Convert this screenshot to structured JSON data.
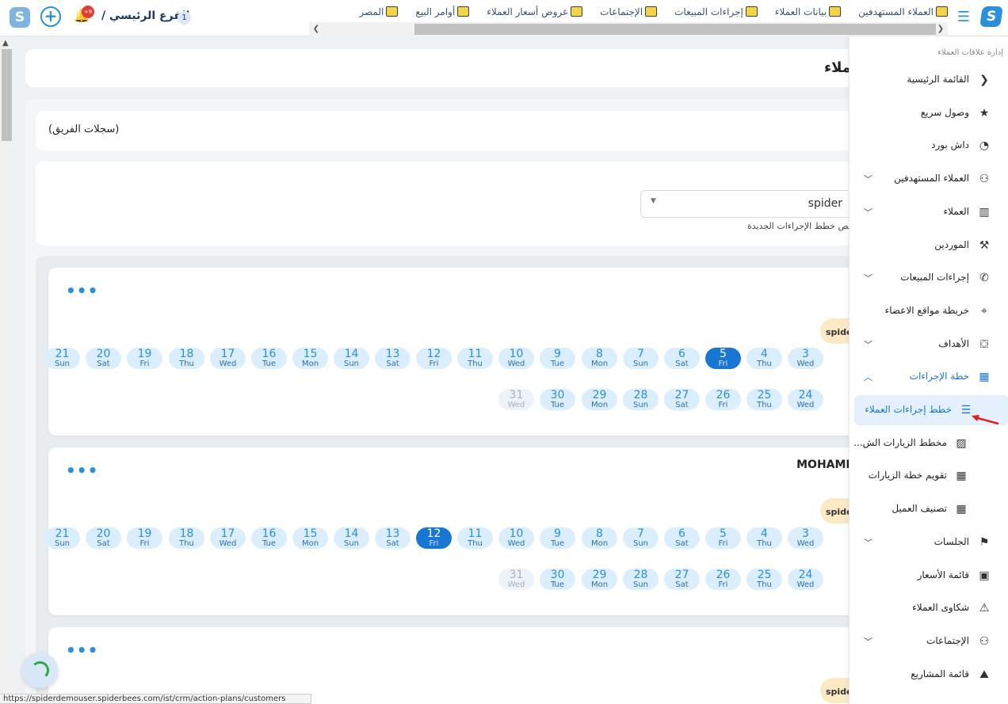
{
  "topbar": {
    "branch_title": "الفرع الرئيسي /",
    "branch_number": "1",
    "notification_badge": "+9",
    "nav": [
      {
        "label": "العملاء المستهدفين",
        "icon": "target-users-icon"
      },
      {
        "label": "بيانات العملاء",
        "icon": "badge-icon"
      },
      {
        "label": "إجراءات المبيعات",
        "icon": "phone-icon"
      },
      {
        "label": "الإجتماعات",
        "icon": "presentation-icon"
      },
      {
        "label": "عروض أسعار العملاء",
        "icon": "price-doc-icon"
      },
      {
        "label": "أوامر البيع",
        "icon": "money-bag-icon"
      },
      {
        "label": "المصر",
        "icon": "laptop-icon"
      }
    ]
  },
  "main": {
    "page_title": "ملاء",
    "team_records": "(سجلات الفريق)",
    "select_value": "spider",
    "hint": "يص خطط الإجراءات الجديدة"
  },
  "cards": [
    {
      "name": "",
      "tag": "spider",
      "row1": [
        {
          "n": "3",
          "w": "Wed"
        },
        {
          "n": "4",
          "w": "Thu"
        },
        {
          "n": "5",
          "w": "Fri",
          "sel": true
        },
        {
          "n": "6",
          "w": "Sat"
        },
        {
          "n": "7",
          "w": "Sun"
        },
        {
          "n": "8",
          "w": "Mon"
        },
        {
          "n": "9",
          "w": "Tue"
        },
        {
          "n": "10",
          "w": "Wed"
        },
        {
          "n": "11",
          "w": "Thu"
        },
        {
          "n": "12",
          "w": "Fri"
        },
        {
          "n": "13",
          "w": "Sat"
        },
        {
          "n": "14",
          "w": "Sun"
        },
        {
          "n": "15",
          "w": "Mon"
        },
        {
          "n": "16",
          "w": "Tue"
        },
        {
          "n": "17",
          "w": "Wed"
        },
        {
          "n": "18",
          "w": "Thu"
        },
        {
          "n": "19",
          "w": "Fri"
        },
        {
          "n": "20",
          "w": "Sat"
        },
        {
          "n": "21",
          "w": "Sun"
        }
      ],
      "row2": [
        {
          "n": "24",
          "w": "Wed"
        },
        {
          "n": "25",
          "w": "Thu"
        },
        {
          "n": "26",
          "w": "Fri"
        },
        {
          "n": "27",
          "w": "Sat"
        },
        {
          "n": "28",
          "w": "Sun"
        },
        {
          "n": "29",
          "w": "Mon"
        },
        {
          "n": "30",
          "w": "Tue"
        },
        {
          "n": "31",
          "w": "Wed",
          "dis": true
        }
      ]
    },
    {
      "name": "MOHAME",
      "tag": "spider",
      "row1": [
        {
          "n": "3",
          "w": "Wed"
        },
        {
          "n": "4",
          "w": "Thu"
        },
        {
          "n": "5",
          "w": "Fri"
        },
        {
          "n": "6",
          "w": "Sat"
        },
        {
          "n": "7",
          "w": "Sun"
        },
        {
          "n": "8",
          "w": "Mon"
        },
        {
          "n": "9",
          "w": "Tue"
        },
        {
          "n": "10",
          "w": "Wed"
        },
        {
          "n": "11",
          "w": "Thu"
        },
        {
          "n": "12",
          "w": "Fri",
          "sel": true
        },
        {
          "n": "13",
          "w": "Sat"
        },
        {
          "n": "14",
          "w": "Sun"
        },
        {
          "n": "15",
          "w": "Mon"
        },
        {
          "n": "16",
          "w": "Tue"
        },
        {
          "n": "17",
          "w": "Wed"
        },
        {
          "n": "18",
          "w": "Thu"
        },
        {
          "n": "19",
          "w": "Fri"
        },
        {
          "n": "20",
          "w": "Sat"
        },
        {
          "n": "21",
          "w": "Sun"
        }
      ],
      "row2": [
        {
          "n": "24",
          "w": "Wed"
        },
        {
          "n": "25",
          "w": "Thu"
        },
        {
          "n": "26",
          "w": "Fri"
        },
        {
          "n": "27",
          "w": "Sat"
        },
        {
          "n": "28",
          "w": "Sun"
        },
        {
          "n": "29",
          "w": "Mon"
        },
        {
          "n": "30",
          "w": "Tue"
        },
        {
          "n": "31",
          "w": "Wed",
          "dis": true
        }
      ]
    },
    {
      "name": "",
      "tag": "spider",
      "row1": [],
      "row2": []
    }
  ],
  "status_url": "https://spiderdemouser.spiderbees.com/ist/crm/action-plans/customers",
  "sidebar": {
    "header": "إدارة علاقات العملاء",
    "items": [
      {
        "label": "القائمة الرئيسية",
        "icon": "chevron-left-icon",
        "glyph": "❮",
        "chev": false
      },
      {
        "label": "وصول سريع",
        "icon": "star-icon",
        "glyph": "★",
        "chev": false
      },
      {
        "label": "داش بورد",
        "icon": "gauge-icon",
        "glyph": "◔",
        "chev": false
      },
      {
        "label": "العملاء المستهدفين",
        "icon": "users-icon",
        "glyph": "⚇",
        "chev": true
      },
      {
        "label": "العملاء",
        "icon": "building-icon",
        "glyph": "▥",
        "chev": true
      },
      {
        "label": "الموردين",
        "icon": "supplier-icon",
        "glyph": "⚒",
        "chev": false
      },
      {
        "label": "إجراءات المبيعات",
        "icon": "phone-icon",
        "glyph": "✆",
        "chev": true
      },
      {
        "label": "خريطة مواقع الاعضاء",
        "icon": "location-icon",
        "glyph": "⌖",
        "chev": false
      },
      {
        "label": "الأهداف",
        "icon": "target-icon",
        "glyph": "⛋",
        "chev": true
      },
      {
        "label": "خطة الإجراءات",
        "icon": "calendar-icon",
        "glyph": "▦",
        "chev": true,
        "open": true,
        "blue": true
      },
      {
        "label": "خطط إجراءات العملاء",
        "icon": "list-icon",
        "glyph": "☰",
        "sub": true,
        "active": true
      },
      {
        "label": "مخطط الزيارات الش...",
        "icon": "chart-icon",
        "glyph": "▨",
        "sub": true
      },
      {
        "label": "تقويم خطة الزيارات",
        "icon": "calendar-grid-icon",
        "glyph": "▦",
        "sub": true
      },
      {
        "label": "تصنيف العميل",
        "icon": "calendar-grid-icon",
        "glyph": "▦",
        "sub": true
      },
      {
        "label": "الجلسات",
        "icon": "sessions-icon",
        "glyph": "⚑",
        "chev": true
      },
      {
        "label": "قائمة الأسعار",
        "icon": "price-list-icon",
        "glyph": "▣",
        "chev": false
      },
      {
        "label": "شكاوى العملاء",
        "icon": "warning-icon",
        "glyph": "⚠",
        "chev": false
      },
      {
        "label": "الإجتماعات",
        "icon": "meeting-icon",
        "glyph": "⚇",
        "chev": true
      },
      {
        "label": "قائمة المشاريع",
        "icon": "projects-icon",
        "glyph": "⛰",
        "chev": false
      }
    ]
  }
}
